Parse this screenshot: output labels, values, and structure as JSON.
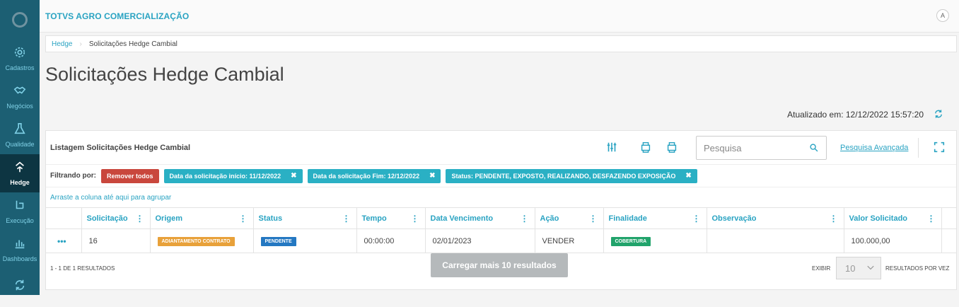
{
  "app": {
    "title": "TOTVS AGRO COMERCIALIZAÇÃO",
    "user_initial": "A"
  },
  "sidebar": {
    "items": [
      {
        "label": "Cadastros",
        "icon": "gear-icon"
      },
      {
        "label": "Negócios",
        "icon": "handshake-icon"
      },
      {
        "label": "Qualidade",
        "icon": "flask-icon"
      },
      {
        "label": "Hedge",
        "icon": "hedge-icon",
        "active": true
      },
      {
        "label": "Execução",
        "icon": "execution-icon"
      },
      {
        "label": "Dashboards",
        "icon": "bar-chart-icon"
      },
      {
        "label": "",
        "icon": "sync-icon"
      }
    ]
  },
  "breadcrumb": {
    "parent": "Hedge",
    "current": "Solicitações Hedge Cambial"
  },
  "page": {
    "title": "Solicitações Hedge Cambial",
    "updated": "Atualizado em: 12/12/2022 15:57:20"
  },
  "card": {
    "title": "Listagem Solicitações Hedge Cambial",
    "search_placeholder": "Pesquisa",
    "advanced_search": "Pesquisa Avançada",
    "filter_label": "Filtrando por:",
    "remove_all": "Remover todos",
    "filters": [
      "Data da solicitação início: 11/12/2022",
      "Data da solicitação Fim: 12/12/2022",
      "Status: PENDENTE, EXPOSTO, REALIZANDO, DESFAZENDO EXPOSIÇÃO"
    ],
    "group_hint": "Arraste a coluna até aqui para agrupar",
    "columns": [
      "Solicitação",
      "Origem",
      "Status",
      "Tempo",
      "Data Vencimento",
      "Ação",
      "Finalidade",
      "Observação",
      "Valor Solicitado"
    ],
    "rows": [
      {
        "solicitacao": "16",
        "origem": "ADIANTAMENTO CONTRATO",
        "status": "PENDENTE",
        "tempo": "00:00:00",
        "vencimento": "02/01/2023",
        "acao": "VENDER",
        "finalidade": "COBERTURA",
        "observacao": "",
        "valor": "100.000,00"
      }
    ],
    "footer": {
      "count": "1 - 1 DE 1 RESULTADOS",
      "load_more": "Carregar mais 10 resultados",
      "exibir": "EXIBIR",
      "page_size": "10",
      "per_page": "RESULTADOS POR VEZ"
    }
  },
  "colors": {
    "sidebar": "#1c5f73",
    "accent": "#29a3c2",
    "danger": "#c9473d",
    "tag": "#2ab0c4"
  }
}
